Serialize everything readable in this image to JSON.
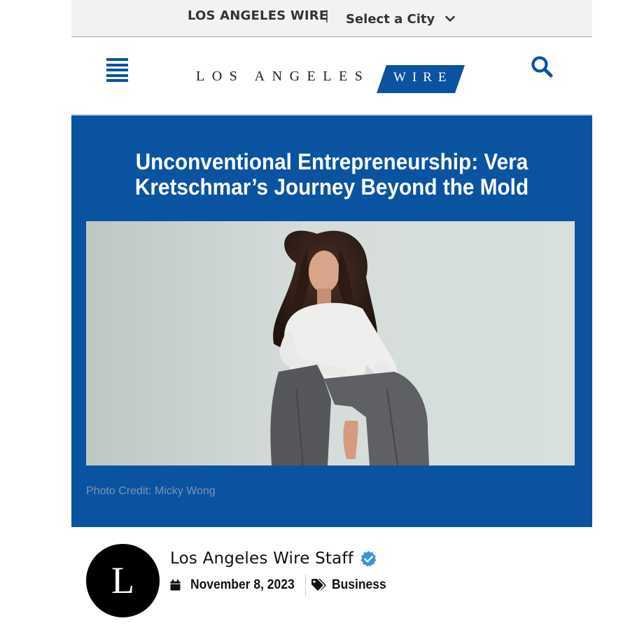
{
  "topbar": {
    "site_name": "LOS ANGELES WIRE",
    "separator": "|",
    "city_select_label": "Select a City",
    "city_select_icon": "chevron-down-icon"
  },
  "header": {
    "menu_icon": "hamburger-menu-icon",
    "logo_text_left": "LOS ANGELES",
    "logo_text_right": "WIRE",
    "search_icon": "search-icon"
  },
  "article": {
    "title": "Unconventional Entrepreneurship: Vera Kretschmar’s Journey Beyond the Mold",
    "photo_credit": "Photo Credit: Micky Wong"
  },
  "author": {
    "avatar_letter": "L",
    "name": "Los Angeles Wire Staff",
    "verified_icon": "verified-badge-icon",
    "date": "November 8, 2023",
    "category": "Business"
  },
  "colors": {
    "brand_blue": "#0a53a1",
    "topbar_bg": "#f2f2f2",
    "verify_blue": "#3d8fe0"
  }
}
